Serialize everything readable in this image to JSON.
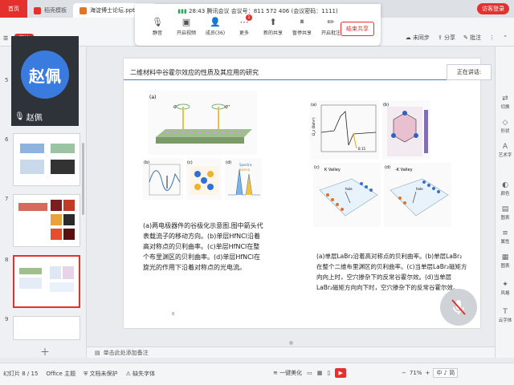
{
  "tabs": {
    "home": "首页",
    "items": [
      {
        "label": "稻壳模板",
        "icon_color": "#e5312d"
      },
      {
        "label": "海淀博士论坛.pptx",
        "icon_color": "#e5731f"
      }
    ],
    "login": "访客登录"
  },
  "ribbon": {
    "start": "开始",
    "right": [
      "未同步",
      "分享",
      "批注"
    ]
  },
  "meeting": {
    "time": "28:43",
    "app": "腾讯会议",
    "meeting_id_label": "会议号：",
    "meeting_id": "811 572 406",
    "passcode": "(会议密码：1111)",
    "tools": [
      {
        "label": "静音",
        "icon": "mic-icon"
      },
      {
        "label": "开启视频",
        "icon": "camera-icon"
      },
      {
        "label": "成员(36)",
        "icon": "members-icon"
      },
      {
        "label": "更多",
        "icon": "more-icon",
        "badge": "1"
      },
      {
        "label": "新的共享",
        "icon": "share-icon"
      },
      {
        "label": "暂停共享",
        "icon": "pause-icon"
      },
      {
        "label": "开启批注",
        "icon": "annotate-icon"
      }
    ],
    "end_share": "结束共享"
  },
  "video": {
    "name": "赵佩",
    "avatar_text": "赵佩",
    "avatar_color": "#3a7be0"
  },
  "thumbs": [
    {
      "num": "5"
    },
    {
      "num": "6"
    },
    {
      "num": "7"
    },
    {
      "num": "8"
    },
    {
      "num": "9"
    }
  ],
  "slide": {
    "title": "二维材料中谷霍尔效应的性质及其应用的研究",
    "left_caption": "(a)两电极器件的谷极化示意图.图中箭头代表载流子的移动方向。(b)单层HfNCl沿着高对称点的贝利曲率。(c)单层HfNCl在整个布里渊区的贝利曲率。(d)单层HfNCl在旋光的作用下沿着对称点的光电流。",
    "right_caption": "(a)单层LaBr₂沿着高对称点的贝利曲率。(b)单层LaBr₂在整个二维布里渊区的贝利曲率。(c)当单层LaBr₂磁矩方向向上时，空穴掺杂下的反常谷霍尔效。(d)当单层LaBr₂磁矩方向向下时，空穴掺杂下的反常谷霍尔效。",
    "fig_labels": {
      "a": "(a)",
      "b": "(b)",
      "c": "(c)",
      "d": "(d)",
      "sigma_minus": "σ⁻",
      "sigma_plus": "σ⁺",
      "legend1": "Spectra",
      "legend2": "Sweep",
      "ylabel": "Ω_z (Bohr²)",
      "k_valley": "K Valley",
      "k2_valley": "-K Valley",
      "hole": "hole",
      "b15": "B 15"
    },
    "page": "8"
  },
  "speaking": "正在讲话:",
  "rail": [
    "切换",
    "形状",
    "艺术字",
    "颜色",
    "图表",
    "属性",
    "图表",
    "风格",
    "云字体"
  ],
  "notes": "单击此处添加备注",
  "status": {
    "slide": "幻灯片 8 / 15",
    "theme": "Office 主题",
    "protect": "文档未保护",
    "font": "缺失字体",
    "beautify": "一键美化",
    "zoom": "71%",
    "ime": [
      "中",
      "♪",
      "简"
    ]
  }
}
